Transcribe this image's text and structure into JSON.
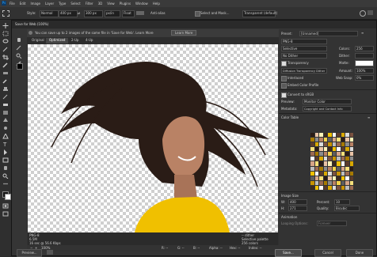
{
  "menubar": {
    "items": [
      "File",
      "Edit",
      "Image",
      "Layer",
      "Type",
      "Select",
      "Filter",
      "3D",
      "View",
      "Plugins",
      "Window",
      "Help"
    ]
  },
  "options_bar": {
    "style_label": "Style:",
    "style_value": "Normal",
    "width_value": "400 px",
    "height_value": "300 px",
    "units_value": "px/in",
    "float_label": "Float",
    "antialias_label": "Anti-alias",
    "refine_label": "Select and Mask...",
    "transparent_value": "Transparent (default)"
  },
  "dialog": {
    "title": "Save for Web (100%)",
    "info_text": "You can save up to 2 images of the same file in 'Save for Web'. Learn More",
    "info_button": "Learn More",
    "tabs": [
      "Original",
      "Optimized",
      "2-Up",
      "4-Up"
    ],
    "active_tab": "Optimized",
    "canvas_info_left": [
      "PNG-8",
      "6.5M",
      "16 sec @ 56.6 Kbps"
    ],
    "canvas_info_right": [
      "-- dither",
      "Selective palette",
      "256 colors"
    ],
    "zoom_value": "100%",
    "r_label": "R: --",
    "g_label": "G: --",
    "b_label": "B: --",
    "alpha_label": "Alpha: --",
    "hex_label": "Hex: --",
    "index_label": "Index: --",
    "preview_button": "Preview...",
    "save_button": "Save...",
    "cancel_button": "Cancel",
    "done_button": "Done"
  },
  "right_panel": {
    "preset_label": "Preset:",
    "preset_value": "[Unnamed]",
    "format_value": "PNG-8",
    "reduction_value": "Selective",
    "dither_algo_value": "No Dither",
    "colors_label": "Colors:",
    "colors_value": "256",
    "dither_label": "Dither:",
    "dither_value": "",
    "transparency_label": "Transparency",
    "matte_label": "Matte:",
    "diffusion_value": "Diffusion Transparency Dither",
    "amount_label": "Amount:",
    "amount_value": "100%",
    "interlaced_label": "Interlaced",
    "websnap_label": "Web Snap:",
    "websnap_value": "0%",
    "embed_label": "Embed Color Profile",
    "convert_label": "Convert to sRGB",
    "preview_label": "Preview:",
    "preview_value": "Monitor Color",
    "metadata_label": "Metadata:",
    "metadata_value": "Copyright and Contact Info",
    "color_table_label": "Color Table",
    "image_size_label": "Image Size",
    "w_label": "W:",
    "w_value": "400",
    "h_label": "H:",
    "h_value": "271",
    "percent_label": "Percent:",
    "percent_value": "10",
    "quality_label": "Quality:",
    "quality_value": "Bicubic",
    "animation_label": "Animation",
    "looping_label": "Looping Options:",
    "looping_value": "Forever"
  },
  "colors": {
    "accent": "#f0c000",
    "panel_bg": "#333333",
    "dark_bg": "#2b2b2b"
  }
}
